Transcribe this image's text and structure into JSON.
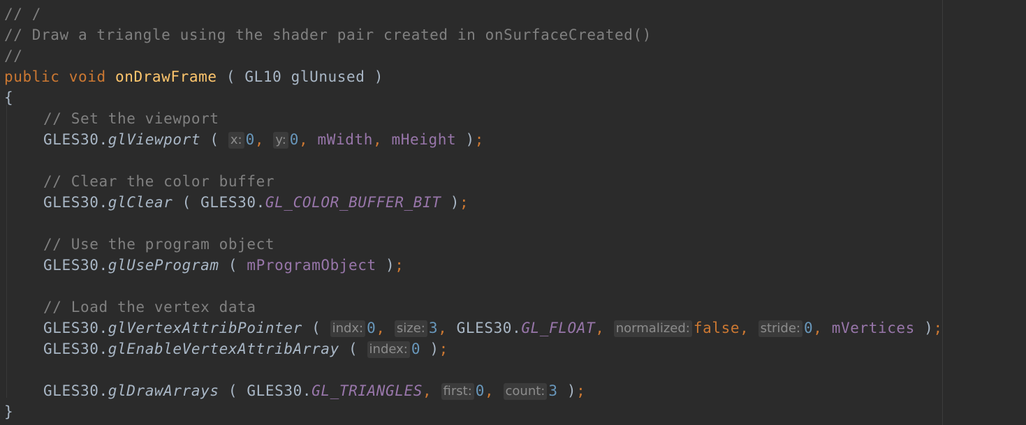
{
  "code": {
    "c1": "// /",
    "c2": "// Draw a triangle using the shader pair created in onSurfaceCreated()",
    "c3": "//",
    "sig_kw_public": "public",
    "sig_kw_void": "void",
    "sig_name": "onDrawFrame",
    "sig_params": " ( GL10 glUnused )",
    "open_brace": "{",
    "close_brace": "}",
    "cm_viewport": "// Set the viewport",
    "cm_clear": "// Clear the color buffer",
    "cm_program": "// Use the program object",
    "cm_vertex": "// Load the vertex data",
    "cls": "GLES30",
    "m_viewport": "glViewport",
    "m_clear": "glClear",
    "m_useprogram": "glUseProgram",
    "m_vap": "glVertexAttribPointer",
    "m_enable": "glEnableVertexAttribArray",
    "m_draw": "glDrawArrays",
    "c_color_buffer_bit": "GL_COLOR_BUFFER_BIT",
    "c_float": "GL_FLOAT",
    "c_triangles": "GL_TRIANGLES",
    "f_width": "mWidth",
    "f_height": "mHeight",
    "f_program": "mProgramObject",
    "f_vertices": "mVertices",
    "kw_false": "false",
    "n0": "0",
    "n3": "3"
  },
  "hints": {
    "x": "x:",
    "y": "y:",
    "indx": "indx:",
    "size": "size:",
    "normalized": "normalized:",
    "stride": "stride:",
    "index": "index:",
    "first": "first:",
    "count": "count:"
  },
  "colors": {
    "background": "#2b2b2b",
    "keyword": "#cc7832",
    "function_decl": "#ffc66d",
    "field": "#9876aa",
    "number": "#6897bb",
    "comment": "#808080",
    "text": "#a9b7c6"
  }
}
